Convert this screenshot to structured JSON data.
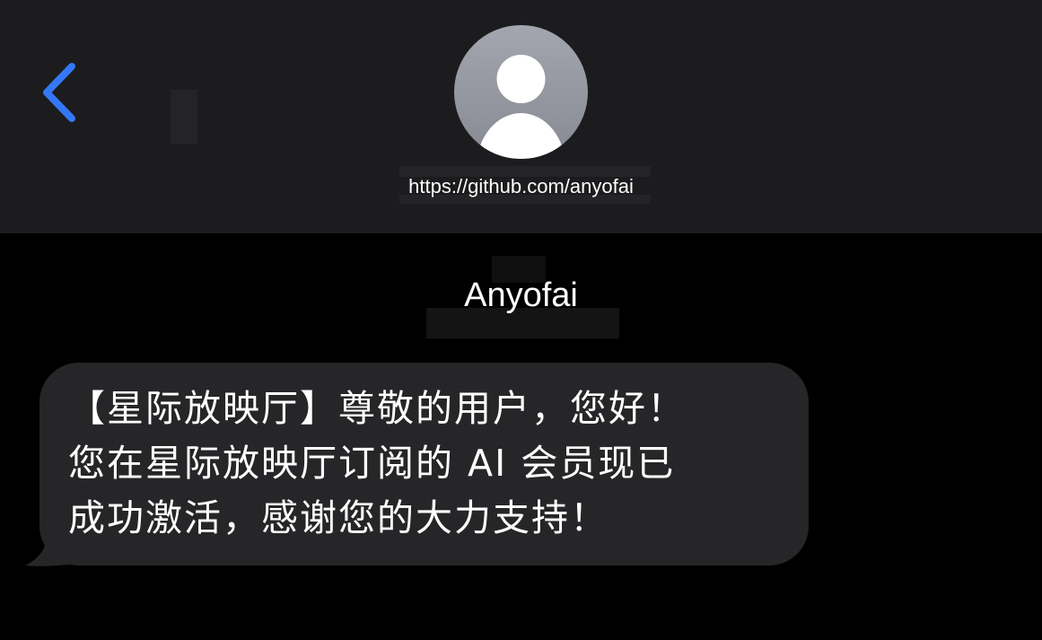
{
  "header": {
    "back_icon": "chevron-left-icon",
    "avatar_icon": "person-silhouette-icon",
    "contact": "https://github.com/anyofai"
  },
  "thread": {
    "sender": "Anyofai",
    "messages": [
      {
        "direction": "incoming",
        "text": "【星际放映厅】尊敬的用户，您好！\n您在星际放映厅订阅的 AI 会员现已\n成功激活，感谢您的大力支持！"
      }
    ]
  },
  "colors": {
    "header_bg": "#1c1c1e",
    "thread_bg": "#000000",
    "bubble_bg": "#262628",
    "accent": "#3478f6",
    "text": "#ffffff"
  }
}
